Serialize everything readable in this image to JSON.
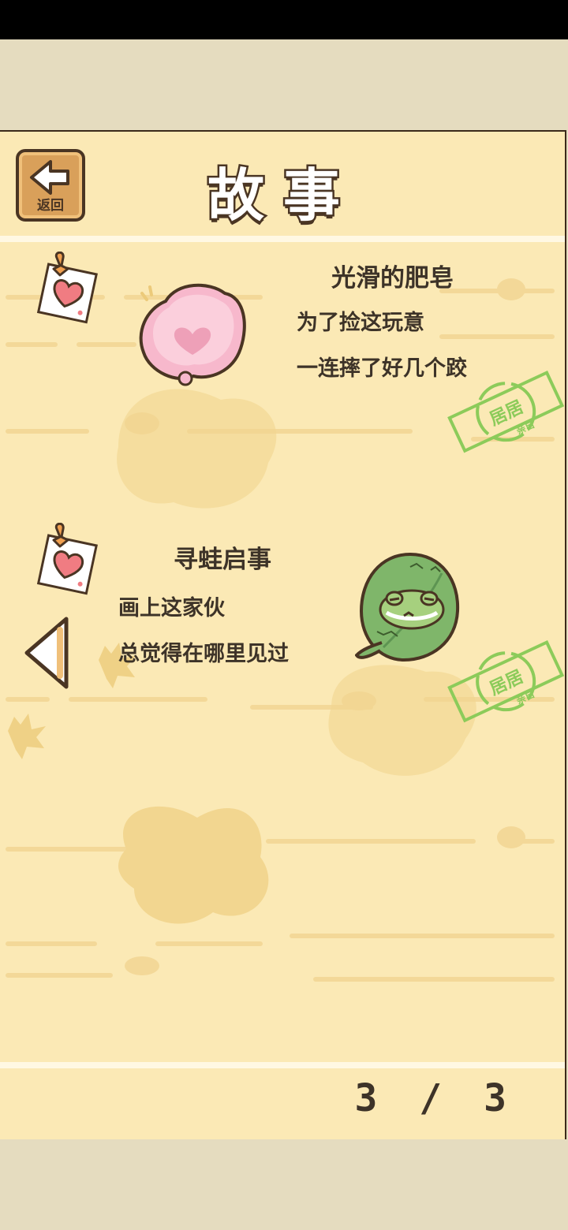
{
  "header": {
    "title": "故事",
    "back_label": "返回"
  },
  "stories": [
    {
      "title": "光滑的肥皂",
      "lines": [
        "为了捡这玩意",
        "一连摔了好几个跤"
      ],
      "stamp_text": "居居",
      "stamp_sub": "亲自",
      "icon": "soap-icon"
    },
    {
      "title": "寻蛙启事",
      "lines": [
        "画上这家伙",
        "总觉得在哪里见过"
      ],
      "stamp_text": "居居",
      "stamp_sub": "亲自",
      "icon": "frog-leaf-icon"
    }
  ],
  "pagination": {
    "current": "3",
    "separator": "/",
    "total": "3"
  }
}
